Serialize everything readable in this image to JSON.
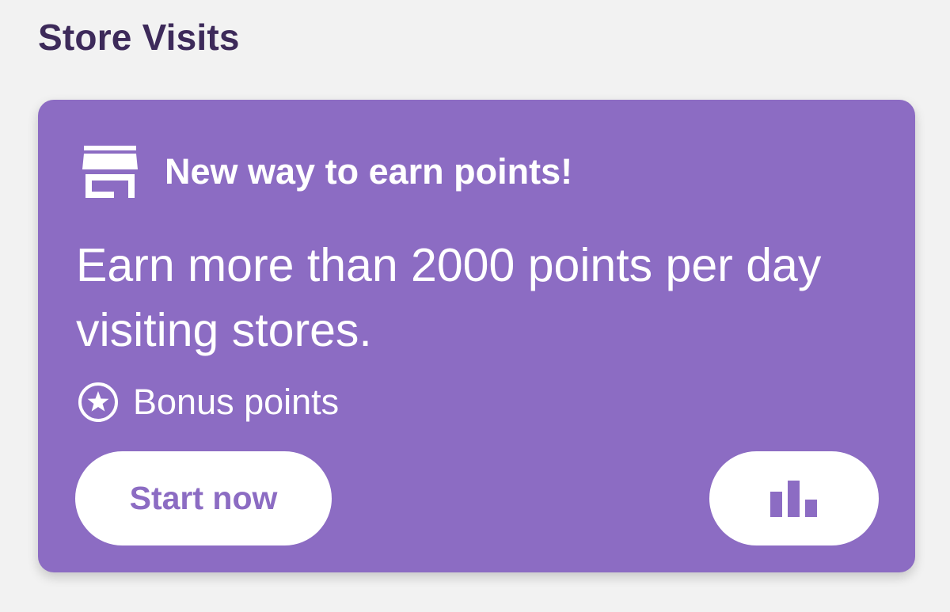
{
  "section": {
    "title": "Store Visits"
  },
  "card": {
    "header_icon": "storefront-icon",
    "header_title": "New way to earn points!",
    "body_text": "Earn more than 2000 points per day visiting stores.",
    "bonus_icon": "star-circle-icon",
    "bonus_label": "Bonus points",
    "start_button_label": "Start now",
    "stats_button_icon": "bar-chart-icon"
  },
  "colors": {
    "page_background": "#f2f2f2",
    "section_title": "#3d2a5a",
    "card_background": "#8c6cc3",
    "text_on_card": "#ffffff",
    "button_background": "#ffffff",
    "button_text": "#8c6cc3"
  }
}
